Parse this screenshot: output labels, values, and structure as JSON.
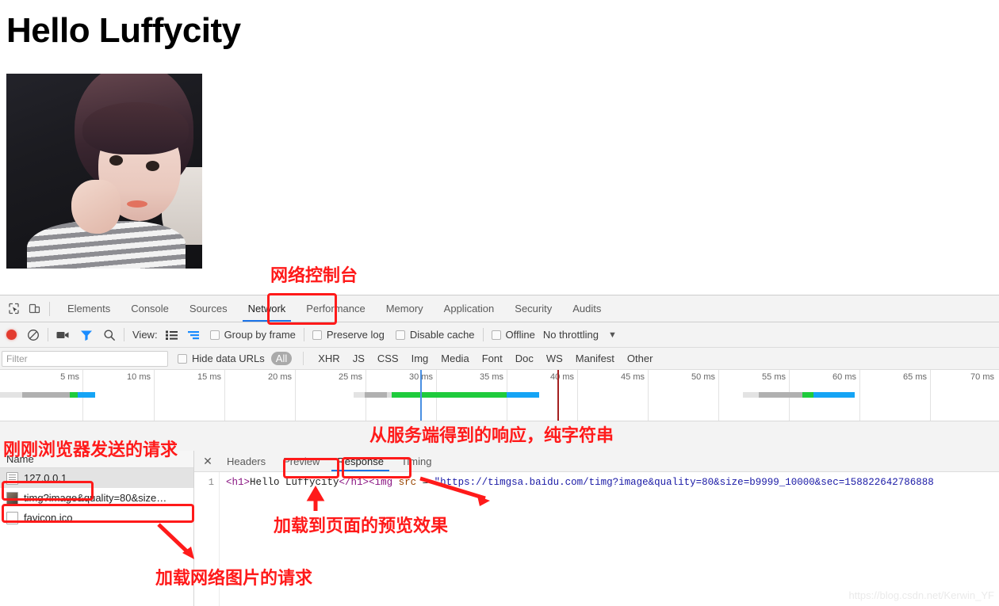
{
  "page": {
    "heading": "Hello Luffycity",
    "photo_alt": "girl-photo"
  },
  "devtools": {
    "main_tabs": [
      {
        "label": "Elements",
        "active": false
      },
      {
        "label": "Console",
        "active": false
      },
      {
        "label": "Sources",
        "active": false
      },
      {
        "label": "Network",
        "active": true
      },
      {
        "label": "Performance",
        "active": false
      },
      {
        "label": "Memory",
        "active": false
      },
      {
        "label": "Application",
        "active": false
      },
      {
        "label": "Security",
        "active": false
      },
      {
        "label": "Audits",
        "active": false
      }
    ],
    "controls": {
      "view_label": "View:",
      "group_by_frame": "Group by frame",
      "preserve_log": "Preserve log",
      "disable_cache": "Disable cache",
      "offline": "Offline",
      "throttling": "No throttling",
      "throttling_caret": "▼"
    },
    "filter": {
      "placeholder": "Filter",
      "value": "",
      "hide_data_urls": "Hide data URLs",
      "types": [
        "All",
        "XHR",
        "JS",
        "CSS",
        "Img",
        "Media",
        "Font",
        "Doc",
        "WS",
        "Manifest",
        "Other"
      ],
      "selected_type": "All"
    },
    "overview": {
      "ticks": [
        "5 ms",
        "10 ms",
        "15 ms",
        "20 ms",
        "25 ms",
        "30 ms",
        "35 ms",
        "40 ms",
        "45 ms",
        "50 ms",
        "55 ms",
        "60 ms",
        "65 ms",
        "70 ms"
      ],
      "dom_content_loaded_color": "#1a73e8",
      "load_event_color": "#c0392b"
    },
    "requests": {
      "column_header": "Name",
      "rows": [
        {
          "name": "127.0.0.1",
          "icon": "document-icon",
          "selected": true
        },
        {
          "name": "timg?image&quality=80&size…",
          "icon": "image-icon",
          "selected": false
        },
        {
          "name": "favicon.ico",
          "icon": "document-icon",
          "selected": false
        }
      ]
    },
    "detail": {
      "close_label": "✕",
      "tabs": [
        {
          "label": "Headers",
          "active": false
        },
        {
          "label": "Preview",
          "active": false
        },
        {
          "label": "Response",
          "active": true
        },
        {
          "label": "Timing",
          "active": false
        }
      ],
      "line_number": "1",
      "code": {
        "open_h1": "<h1>",
        "text": "Hello Luffycity",
        "close_h1": "</h1>",
        "open_img": "<img",
        "attr_src": "src",
        "equals": " = ",
        "url": "\"https://timgsa.baidu.com/timg?image&quality=80&size=b9999_10000&sec=158822642786888"
      }
    }
  },
  "annotations": [
    {
      "id": "network-console",
      "text": "网络控制台"
    },
    {
      "id": "browser-request",
      "text": "刚刚浏览器发送的请求"
    },
    {
      "id": "server-response",
      "text": "从服务端得到的响应，纯字符串"
    },
    {
      "id": "preview-effect",
      "text": "加载到页面的预览效果"
    },
    {
      "id": "image-request",
      "text": "加载网络图片的请求"
    }
  ],
  "watermark": "https://blog.csdn.net/Kerwin_YF"
}
